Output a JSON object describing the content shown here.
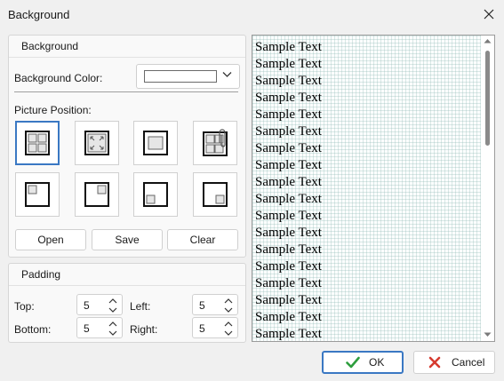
{
  "window": {
    "title": "Background"
  },
  "background_panel": {
    "header": "Background",
    "color_label": "Background Color:",
    "color_value": "#ffffff",
    "picture_position_label": "Picture Position:",
    "positions": [
      {
        "icon": "tile-icon",
        "selected": true
      },
      {
        "icon": "stretch-icon",
        "selected": false
      },
      {
        "icon": "center-icon",
        "selected": false
      },
      {
        "icon": "attach-icon",
        "selected": false
      },
      {
        "icon": "top-left-icon",
        "selected": false
      },
      {
        "icon": "top-right-icon",
        "selected": false
      },
      {
        "icon": "bottom-left-icon",
        "selected": false
      },
      {
        "icon": "bottom-right-icon",
        "selected": false
      }
    ],
    "open_label": "Open",
    "save_label": "Save",
    "clear_label": "Clear"
  },
  "padding_panel": {
    "header": "Padding",
    "top_label": "Top:",
    "top_value": "5",
    "left_label": "Left:",
    "left_value": "5",
    "bottom_label": "Bottom:",
    "bottom_value": "5",
    "right_label": "Right:",
    "right_value": "5"
  },
  "preview": {
    "lines": [
      "Sample Text",
      "Sample Text",
      "Sample Text",
      "Sample Text",
      "Sample Text",
      "Sample Text",
      "Sample Text",
      "Sample Text",
      "Sample Text",
      "Sample Text",
      "Sample Text",
      "Sample Text",
      "Sample Text",
      "Sample Text",
      "Sample Text",
      "Sample Text",
      "Sample Text",
      "Sample Text"
    ]
  },
  "footer": {
    "ok_label": "OK",
    "cancel_label": "Cancel"
  },
  "colors": {
    "accent": "#3a78c3",
    "ok_check": "#2e9e3e",
    "cancel_x": "#d63a2f"
  }
}
